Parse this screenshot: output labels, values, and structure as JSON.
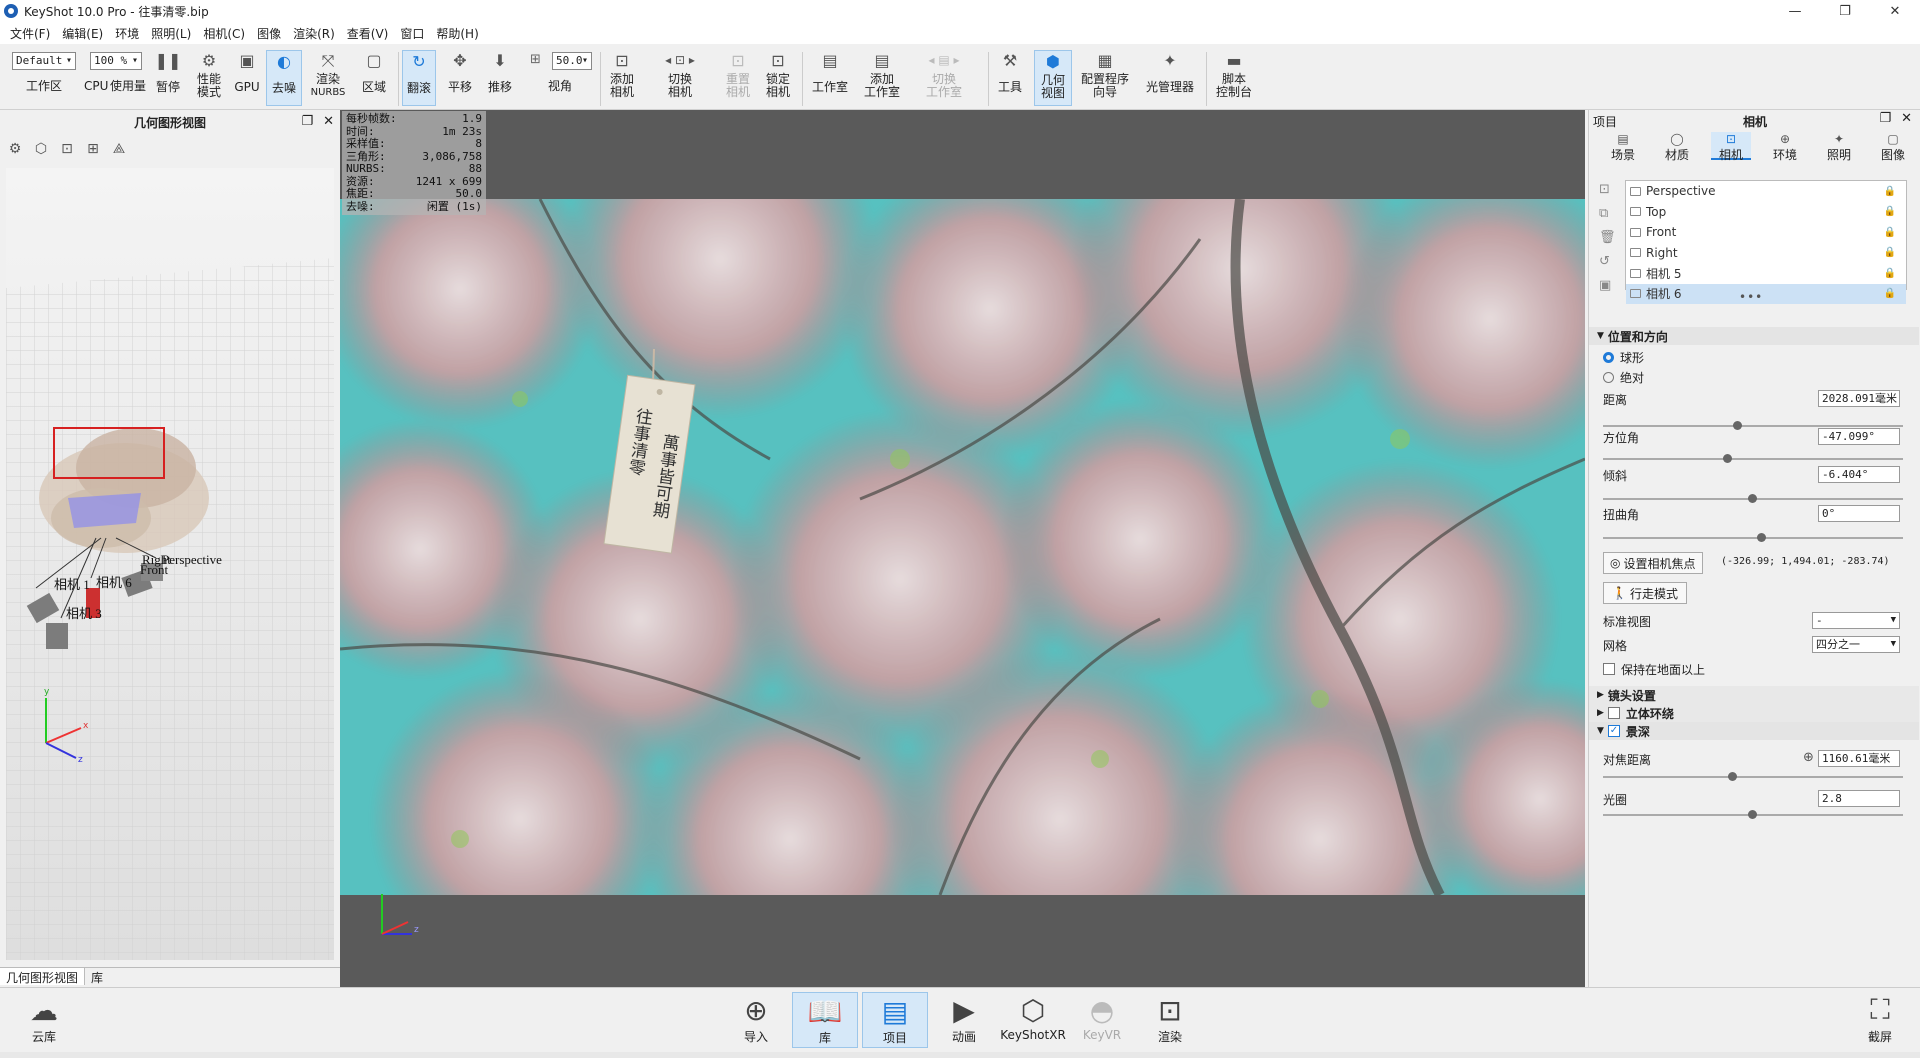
{
  "window": {
    "title": "KeyShot 10.0 Pro  - 往事清零.bip",
    "controls": [
      "—",
      "❐",
      "✕"
    ]
  },
  "menu": [
    "文件(F)",
    "编辑(E)",
    "环境",
    "照明(L)",
    "相机(C)",
    "图像",
    "渲染(R)",
    "查看(V)",
    "窗口",
    "帮助(H)"
  ],
  "toolbar": {
    "workspace_select": "Default",
    "zoom_select": "100 %",
    "fov_value": "50.0",
    "labels": {
      "workspace": "工作区",
      "cpu": "CPU",
      "usage": "使用量",
      "pause": "暂停",
      "perf1": "性能",
      "perf2": "模式",
      "gpu": "GPU",
      "denoise": "去噪",
      "nurbs1": "渲染",
      "nurbs2": "NURBS",
      "region": "区域",
      "tumble": "翻滚",
      "pan": "平移",
      "dolly": "推移",
      "fov": "视角",
      "addcam1": "添加",
      "addcam2": "相机",
      "switchcam1": "切换",
      "switchcam2": "相机",
      "resetcam1": "重置",
      "resetcam2": "相机",
      "lockcam1": "锁定",
      "lockcam2": "相机",
      "studio": "工作室",
      "addstudio1": "添加",
      "addstudio2": "工作室",
      "switchstudio1": "切换",
      "switchstudio2": "工作室",
      "tools": "工具",
      "geoview1": "几何",
      "geoview2": "视图",
      "config1": "配置程序",
      "config2": "向导",
      "lightmgr": "光管理器",
      "script1": "脚本",
      "script2": "控制台"
    }
  },
  "left_panel": {
    "title": "几何图形视图",
    "tabs": [
      "几何图形视图",
      "库"
    ],
    "camera_labels": [
      "相机 1",
      "相机 6",
      "相机 3",
      "Right",
      "Front",
      "Perspective"
    ]
  },
  "stats": [
    {
      "k": "每秒帧数:",
      "v": "1.9"
    },
    {
      "k": "时间:",
      "v": "1m 23s"
    },
    {
      "k": "采样值:",
      "v": "8"
    },
    {
      "k": "三角形:",
      "v": "3,086,758"
    },
    {
      "k": "NURBS:",
      "v": "88"
    },
    {
      "k": "资源:",
      "v": "1241 x 699"
    },
    {
      "k": "焦距:",
      "v": "50.0"
    },
    {
      "k": "去噪:",
      "v": "闲置 (1s)"
    }
  ],
  "tag_text": {
    "col1": "往事清零",
    "col2": "萬事皆可期"
  },
  "right_panel": {
    "header_left": "项目",
    "header_title": "相机",
    "tabs": [
      "场景",
      "材质",
      "相机",
      "环境",
      "照明",
      "图像"
    ],
    "cameras": [
      "Perspective",
      "Top",
      "Front",
      "Right",
      "相机 5",
      "相机 6"
    ],
    "section_position": "位置和方向",
    "radio_sphere": "球形",
    "radio_absolute": "绝对",
    "distance_label": "距离",
    "distance": "2028.091毫米",
    "azimuth_label": "方位角",
    "azimuth": "-47.099°",
    "incline_label": "倾斜",
    "incline": "-6.404°",
    "twist_label": "扭曲角",
    "twist": "0°",
    "set_focus_btn": "设置相机焦点",
    "focus_coords": "(-326.99; 1,494.01; -283.74)",
    "walk_mode_btn": "行走模式",
    "std_view_label": "标准视图",
    "std_view": "-",
    "grid_label": "网格",
    "grid": "四分之一",
    "keep_above": "保持在地面以上",
    "lens_section": "镜头设置",
    "stereo_section": "立体环绕",
    "dof_section": "景深",
    "focus_dist_label": "对焦距离",
    "focus_dist": "1160.61毫米",
    "aperture_label": "光圈",
    "aperture": "2.8"
  },
  "bottom": {
    "cloud": "云库",
    "import": "导入",
    "library": "库",
    "project": "项目",
    "animation": "动画",
    "keyshotxr": "KeyShotXR",
    "keyvr": "KeyVR",
    "render": "渲染",
    "screenshot": "截屏"
  }
}
